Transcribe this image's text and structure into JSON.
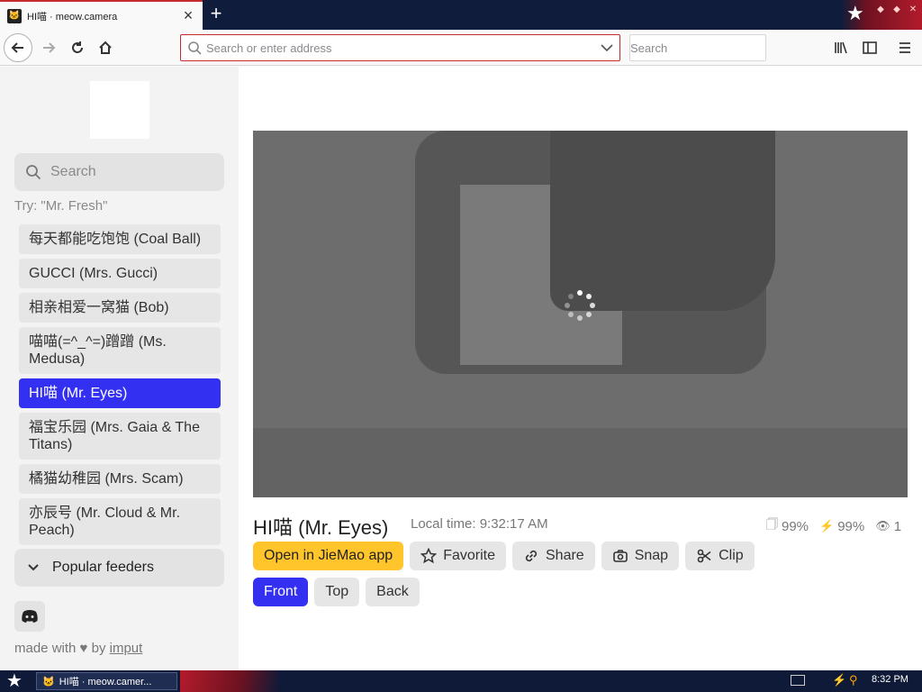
{
  "browser": {
    "tab": {
      "title": "HI喵 · meow.camera",
      "favicon": "cat-face-icon"
    },
    "urlbar": {
      "placeholder": "Search or enter address"
    },
    "searchbar": {
      "placeholder": "Search"
    }
  },
  "sidebar": {
    "search_placeholder": "Search",
    "try_text": "Try: \"Mr. Fresh\"",
    "cameras": [
      {
        "label": "每天都能吃饱饱 (Coal Ball)"
      },
      {
        "label": "GUCCI (Mrs. Gucci)"
      },
      {
        "label": "相亲相爱一窝猫 (Bob)"
      },
      {
        "label": "喵喵(=^_^=)蹭蹭 (Ms. Medusa)"
      },
      {
        "label": "HI喵 (Mr. Eyes)"
      },
      {
        "label": "福宝乐园 (Mrs. Gaia & The Titans)"
      },
      {
        "label": "橘猫幼稚园 (Mrs. Scam)"
      },
      {
        "label": "亦辰号 (Mr. Cloud & Mr. Peach)"
      }
    ],
    "active_index": 4,
    "popular_label": "Popular feeders",
    "footer": {
      "made_with": "made with",
      "by": "by",
      "author": "imput"
    }
  },
  "camera": {
    "title": "HI喵 (Mr. Eyes)",
    "local_time": "Local time: 9:32:17 AM",
    "food_level": "99%",
    "battery_level": "99%",
    "viewers": "1",
    "buttons": {
      "open_app": "Open in JieMao app",
      "favorite": "Favorite",
      "share": "Share",
      "snap": "Snap",
      "clip": "Clip"
    },
    "views": [
      "Front",
      "Top",
      "Back"
    ],
    "active_view": "Front"
  },
  "taskbar": {
    "task_title": "HI喵 · meow.camer...",
    "clock": "8:32 PM"
  },
  "colors": {
    "accent": "#3330f2",
    "yellow": "#ffc52a",
    "urlbar_border": "#c42b2b"
  }
}
